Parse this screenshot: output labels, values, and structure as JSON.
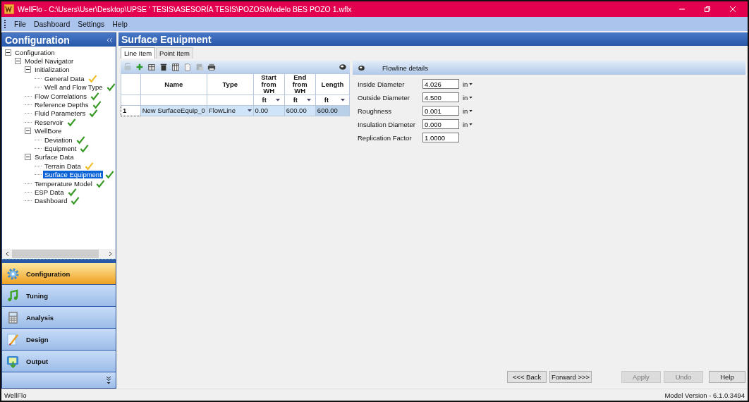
{
  "window": {
    "title": "WellFlo - C:\\Users\\User\\Desktop\\UPSE ' TESIS\\ASESORÍA TESIS\\POZOS\\Modelo BES POZO 1.wflx"
  },
  "menu": [
    "File",
    "Dashboard",
    "Settings",
    "Help"
  ],
  "sidebar": {
    "title": "Configuration",
    "tree": [
      {
        "label": "Configuration",
        "expanded": true,
        "children": [
          {
            "label": "Model Navigator",
            "expanded": true,
            "children": [
              {
                "label": "Initialization",
                "expanded": true,
                "children": [
                  {
                    "label": "General Data",
                    "complete": false,
                    "selected": false
                  },
                  {
                    "label": "Well and Flow Type",
                    "complete": true,
                    "selected": false
                  }
                ]
              },
              {
                "label": "Flow Correlations",
                "complete": true,
                "selected": false
              },
              {
                "label": "Reference Depths",
                "complete": true,
                "selected": false
              },
              {
                "label": "Fluid Parameters",
                "complete": true,
                "selected": false
              },
              {
                "label": "Reservoir",
                "complete": true,
                "selected": false
              },
              {
                "label": "WellBore",
                "expanded": true,
                "children": [
                  {
                    "label": "Deviation",
                    "complete": true,
                    "selected": false
                  },
                  {
                    "label": "Equipment",
                    "complete": true,
                    "selected": false
                  }
                ]
              },
              {
                "label": "Surface Data",
                "expanded": true,
                "children": [
                  {
                    "label": "Terrain Data",
                    "complete": false,
                    "selected": false
                  },
                  {
                    "label": "Surface Equipment",
                    "complete": true,
                    "selected": true
                  }
                ]
              },
              {
                "label": "Temperature Model",
                "complete": true,
                "selected": false
              },
              {
                "label": "ESP Data",
                "complete": true,
                "selected": false
              },
              {
                "label": "Dashboard",
                "complete": true,
                "selected": false
              }
            ]
          }
        ]
      }
    ],
    "nav": [
      {
        "label": "Configuration",
        "kind": "gear",
        "selected": true
      },
      {
        "label": "Tuning",
        "kind": "music",
        "selected": false
      },
      {
        "label": "Analysis",
        "kind": "calculator",
        "selected": false
      },
      {
        "label": "Design",
        "kind": "pencil",
        "selected": false
      },
      {
        "label": "Output",
        "kind": "output",
        "selected": false
      }
    ]
  },
  "main": {
    "title": "Surface Equipment",
    "tabs": [
      {
        "label": "Line Item",
        "selected": true
      },
      {
        "label": "Point Item",
        "selected": false
      }
    ],
    "table": {
      "columns": [
        {
          "name": "Name"
        },
        {
          "name": "Type"
        },
        {
          "name": "Start from WH",
          "unit": "ft"
        },
        {
          "name": "End from WH",
          "unit": "ft"
        },
        {
          "name": "Length",
          "unit": "ft"
        }
      ],
      "rows": [
        {
          "index": "1",
          "cells": [
            "New SurfaceEquip_0",
            "FlowLine",
            "0.00",
            "600.00",
            "600.00"
          ]
        }
      ]
    },
    "details": {
      "title": "Flowline details",
      "fields": [
        {
          "label": "Inside Diameter",
          "value": "4.026",
          "unit": "in"
        },
        {
          "label": "Outside Diameter",
          "value": "4.500",
          "unit": "in"
        },
        {
          "label": "Roughness",
          "value": "0.001",
          "unit": "in"
        },
        {
          "label": "Insulation Diameter",
          "value": "0.000",
          "unit": "in"
        },
        {
          "label": "Replication Factor",
          "value": "1.0000"
        }
      ]
    },
    "buttons": [
      {
        "label": "<<< Back",
        "disabled": false
      },
      {
        "label": "Forward >>>",
        "disabled": false
      },
      {
        "label": "Apply",
        "disabled": true
      },
      {
        "label": "Undo",
        "disabled": true
      },
      {
        "label": "Help",
        "disabled": false
      }
    ]
  },
  "status_bar": {
    "left": "WellFlo",
    "right": "Model Version - 6.1.0.3494"
  }
}
